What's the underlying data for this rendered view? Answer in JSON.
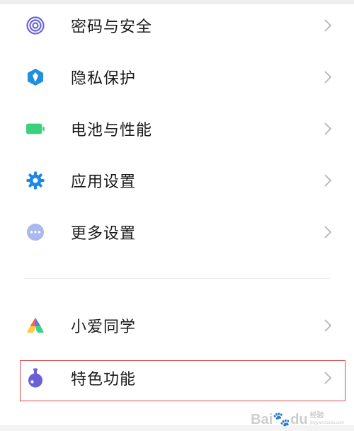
{
  "settings": {
    "items": [
      {
        "label": "密码与安全",
        "icon": "fingerprint-icon"
      },
      {
        "label": "隐私保护",
        "icon": "privacy-shield-icon"
      },
      {
        "label": "电池与性能",
        "icon": "battery-icon"
      },
      {
        "label": "应用设置",
        "icon": "gear-icon"
      },
      {
        "label": "更多设置",
        "icon": "more-dots-icon"
      },
      {
        "label": "小爱同学",
        "icon": "xiaoai-icon"
      },
      {
        "label": "特色功能",
        "icon": "flask-icon"
      }
    ],
    "chevron": ">"
  },
  "watermark": {
    "logo": "Bai",
    "logo2": "du",
    "text": "经验",
    "url": "jingyan.baidu.com"
  },
  "colors": {
    "fingerprint": "#6b63d9",
    "privacy": "#1f8fe0",
    "battery": "#3bd17a",
    "gear": "#1e88e5",
    "more": "#a9b8ef",
    "flask": "#6a5fd8",
    "highlight_border": "#d54a4a"
  }
}
